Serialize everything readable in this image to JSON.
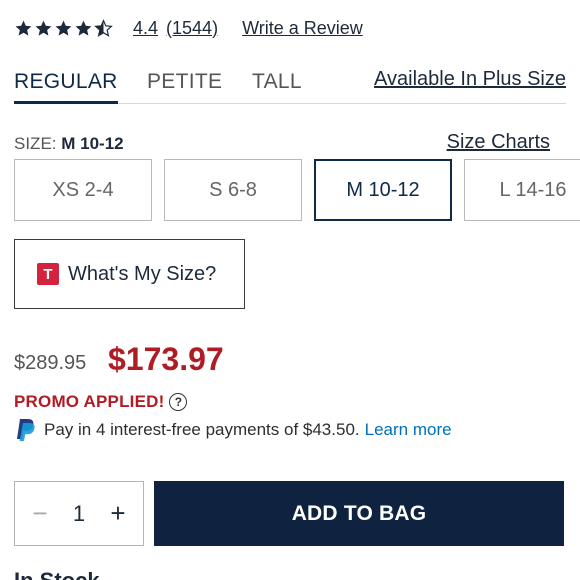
{
  "rating": {
    "value": "4.4",
    "count": "(1544)",
    "stars_filled": 4.4,
    "write_review_label": "Write a Review",
    "star_color": "#1d2a3a"
  },
  "tabs": {
    "items": [
      {
        "label": "REGULAR",
        "active": true
      },
      {
        "label": "PETITE",
        "active": false
      },
      {
        "label": "TALL",
        "active": false
      }
    ],
    "plus_size_label": "Available In Plus Size"
  },
  "size": {
    "label_prefix": "SIZE: ",
    "selected": "M 10-12",
    "charts_label": "Size Charts",
    "options": [
      {
        "label": "XS 2-4",
        "selected": false
      },
      {
        "label": "S 6-8",
        "selected": false
      },
      {
        "label": "M 10-12",
        "selected": true
      },
      {
        "label": "L 14-16",
        "selected": false
      }
    ],
    "whats_my_size_label": "What's My Size?",
    "logo_letter": "T"
  },
  "price": {
    "original": "$289.95",
    "sale": "$173.97",
    "promo_label": "PROMO APPLIED!",
    "help_icon": "?",
    "paypal_text": "Pay in 4 interest-free payments of $43.50.",
    "learn_more_label": "Learn more"
  },
  "cart": {
    "minus_icon": "−",
    "quantity": "1",
    "plus_icon": "+",
    "add_to_bag_label": "ADD TO BAG"
  },
  "stock_text": "In Stock",
  "colors": {
    "navy": "#0f2340",
    "sale_red": "#b01c24",
    "paypal_blue": "#0070ba",
    "t_logo_red": "#d2243f"
  }
}
